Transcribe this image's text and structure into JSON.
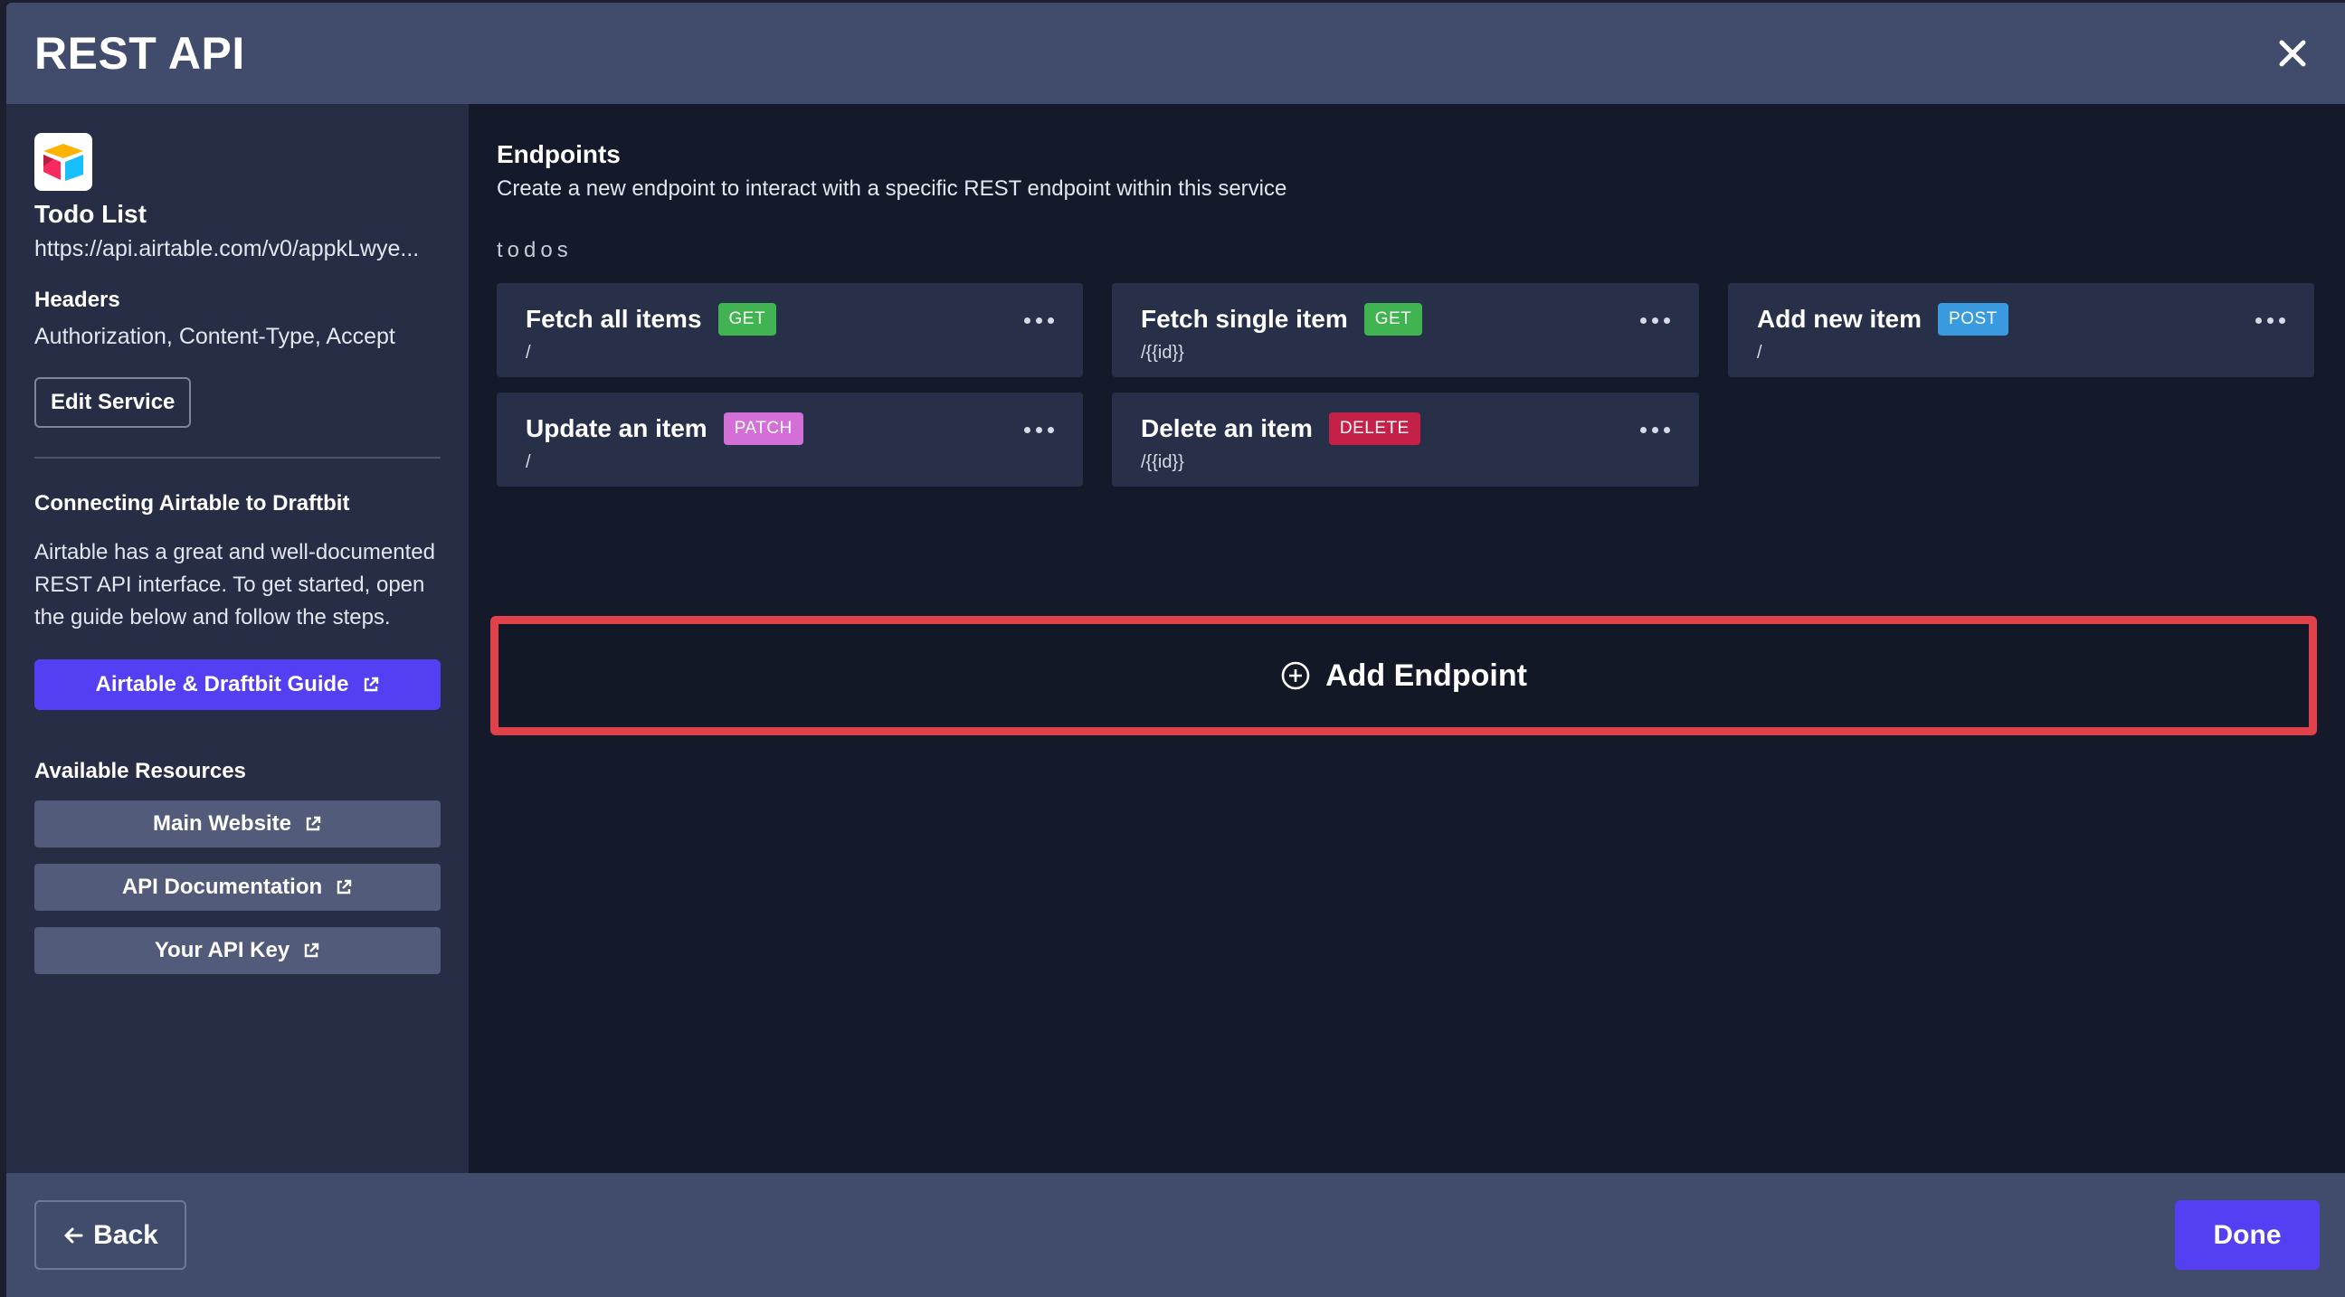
{
  "modal": {
    "title": "REST API"
  },
  "sidebar": {
    "service_name": "Todo List",
    "service_url": "https://api.airtable.com/v0/appkLwye...",
    "headers_label": "Headers",
    "headers_value": "Authorization, Content-Type, Accept",
    "edit_service_label": "Edit Service",
    "connect_title": "Connecting Airtable to Draftbit",
    "connect_desc": "Airtable has a great and well-documented REST API interface. To get started, open the guide below and follow the steps.",
    "guide_label": "Airtable & Draftbit Guide",
    "resources_title": "Available Resources",
    "resources": [
      {
        "label": "Main Website"
      },
      {
        "label": "API Documentation"
      },
      {
        "label": "Your API Key"
      }
    ]
  },
  "main": {
    "endpoints_title": "Endpoints",
    "endpoints_desc": "Create a new endpoint to interact with a specific REST endpoint within this service",
    "group_label": "todos",
    "endpoints": [
      {
        "title": "Fetch all items",
        "method": "GET",
        "method_color": "#3fb450",
        "path": "/"
      },
      {
        "title": "Fetch single item",
        "method": "GET",
        "method_color": "#3fb450",
        "path": "/{{id}}"
      },
      {
        "title": "Add new item",
        "method": "POST",
        "method_color": "#3a9ae0",
        "path": "/"
      },
      {
        "title": "Update an item",
        "method": "PATCH",
        "method_color": "#d46fd8",
        "path": "/"
      },
      {
        "title": "Delete an item",
        "method": "DELETE",
        "method_color": "#c52047",
        "path": "/{{id}}"
      }
    ],
    "add_endpoint_label": "Add Endpoint"
  },
  "footer": {
    "back_label": "Back",
    "done_label": "Done"
  },
  "colors": {
    "accent": "#5440f2",
    "highlight": "#e0414a"
  }
}
